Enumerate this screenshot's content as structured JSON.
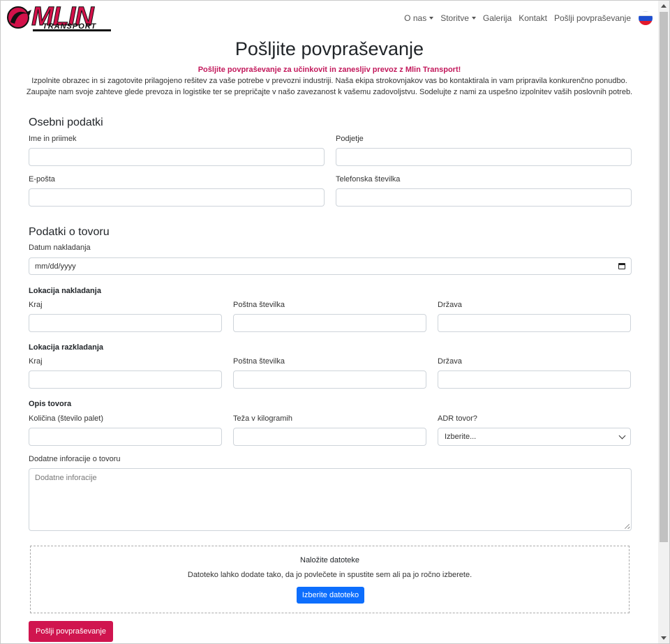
{
  "brand": {
    "name": "MLIN",
    "subtitle": "TRANSPORT",
    "accent": "#d3114a"
  },
  "nav": {
    "items": [
      {
        "label": "O nas",
        "dropdown": true
      },
      {
        "label": "Storitve",
        "dropdown": true
      },
      {
        "label": "Galerija",
        "dropdown": false
      },
      {
        "label": "Kontakt",
        "dropdown": false
      },
      {
        "label": "Pošlji povpraševanje",
        "dropdown": false
      }
    ],
    "language_icon": "slovenia-flag-icon"
  },
  "page": {
    "title": "Pošljite povpraševanje",
    "lead": "Pošljite povpraševanje za učinkovit in zanesljiv prevoz z Mlin Transport!",
    "intro_line1": "Izpolnite obrazec in si zagotovite prilagojeno rešitev za vaše potrebe v prevozni industriji. Naša ekipa strokovnjakov vas bo kontaktirala in vam pripravila konkurenčno ponudbo.",
    "intro_line2": "Zaupajte nam svoje zahteve glede prevoza in logistike ter se prepričajte v našo zavezanost k vašemu zadovoljstvu. Sodelujte z nami za uspešno izpolnitev vaših poslovnih potreb."
  },
  "personal": {
    "title": "Osebni podatki",
    "name_label": "Ime in priimek",
    "company_label": "Podjetje",
    "email_label": "E-pošta",
    "phone_label": "Telefonska številka"
  },
  "cargo": {
    "title": "Podatki o tovoru",
    "date_label": "Datum nakladanja",
    "date_placeholder": "mm/dd/yyyy",
    "loading": {
      "title": "Lokacija nakladanja",
      "city": "Kraj",
      "postal": "Poštna številka",
      "country": "Država"
    },
    "unloading": {
      "title": "Lokacija razkladanja",
      "city": "Kraj",
      "postal": "Poštna številka",
      "country": "Država"
    },
    "desc_title": "Opis tovora",
    "quantity_label": "Količina (število palet)",
    "weight_label": "Teža v kilogramih",
    "adr_label": "ADR tovor?",
    "adr_selected": "Izberite...",
    "extra_label": "Dodatne inforacije o tovoru",
    "extra_placeholder": "Dodatne inforacije"
  },
  "upload": {
    "title": "Naložite datoteke",
    "text": "Datoteko lahko dodate tako, da jo povlečete in spustite sem ali pa jo ročno izberete.",
    "button": "Izberite datoteko"
  },
  "submit_label": "Pošlji povpraševanje",
  "colors": {
    "primary": "#0d6efd",
    "submit": "#d0154f",
    "lead": "#c2185b"
  }
}
